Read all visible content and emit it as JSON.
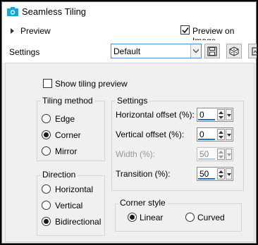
{
  "window": {
    "title": "Seamless Tiling",
    "icon": "seamless-tiling-app-icon"
  },
  "preview": {
    "label": "Preview",
    "preview_on_image_label": "Preview on Image",
    "preview_on_image_checked": true
  },
  "settings": {
    "label": "Settings",
    "preset_value": "Default",
    "buttons": [
      "save-preset-icon",
      "randomize-icon",
      "reset-icon"
    ]
  },
  "show_tiling_preview": {
    "label": "Show tiling preview",
    "checked": false
  },
  "tiling_method": {
    "title": "Tiling method",
    "options": [
      {
        "label": "Edge",
        "checked": false
      },
      {
        "label": "Corner",
        "checked": true
      },
      {
        "label": "Mirror",
        "checked": false
      }
    ]
  },
  "direction": {
    "title": "Direction",
    "options": [
      {
        "label": "Horizontal",
        "checked": false
      },
      {
        "label": "Vertical",
        "checked": false
      },
      {
        "label": "Bidirectional",
        "checked": true
      }
    ]
  },
  "params": {
    "title": "Settings",
    "horizontal_offset": {
      "label": "Horizontal offset (%):",
      "value": "0"
    },
    "vertical_offset": {
      "label": "Vertical offset (%):",
      "value": "0"
    },
    "width": {
      "label": "Width (%):",
      "value": "50",
      "enabled": false
    },
    "transition": {
      "label": "Transition (%):",
      "value": "50"
    }
  },
  "corner_style": {
    "title": "Corner style",
    "options": [
      {
        "label": "Linear",
        "checked": true
      },
      {
        "label": "Curved",
        "checked": false
      }
    ]
  },
  "colors": {
    "accent": "#1f6fd1",
    "app_icon": "#1aa3d8"
  }
}
